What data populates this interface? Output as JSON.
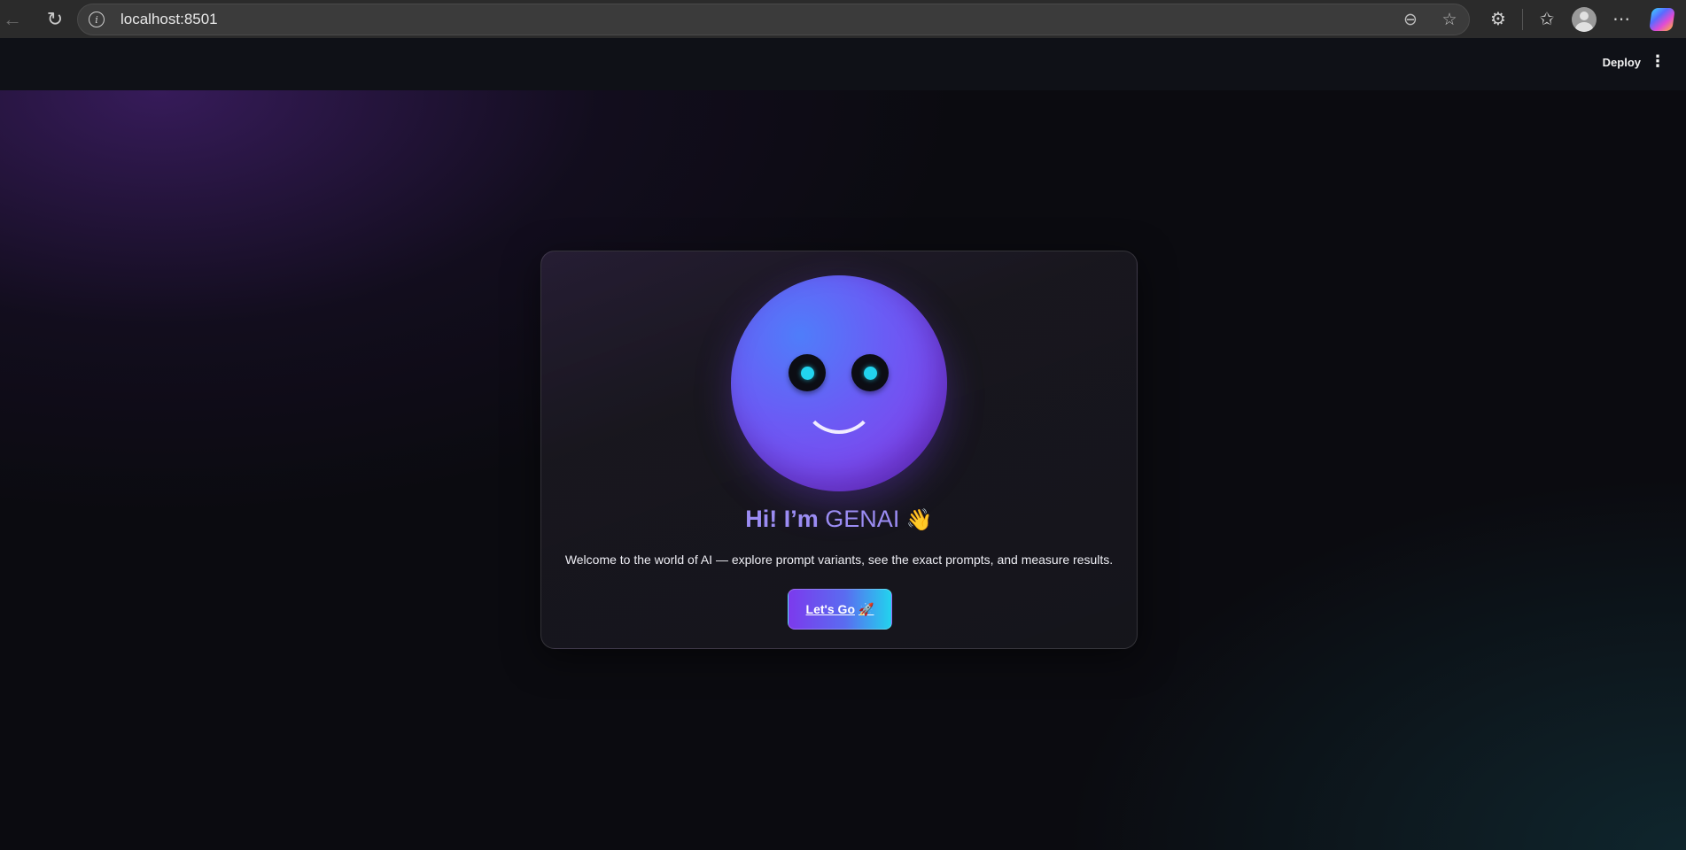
{
  "browser": {
    "url": "localhost:8501",
    "icons": [
      "back-arrow-icon",
      "reload-icon",
      "info-icon",
      "zoom-out-icon",
      "star-icon",
      "extensions-icon",
      "favorites-icon",
      "profile-icon",
      "more-icon",
      "copilot-icon"
    ]
  },
  "header": {
    "deploy_label": "Deploy",
    "menu_glyph": "⋮"
  },
  "hero": {
    "title_bold": "Hi! I’m",
    "title_name": "GENAI",
    "title_emoji": "👋",
    "subtitle": "Welcome to the world of AI — explore prompt variants, see the exact prompts, and measure results.",
    "cta_label": "Let's Go",
    "cta_emoji": "🚀"
  },
  "colors": {
    "accent_purple": "#7c3aed",
    "accent_cyan": "#22d3ee",
    "title_color": "#9b8cf3",
    "background": "#0b0b10"
  }
}
